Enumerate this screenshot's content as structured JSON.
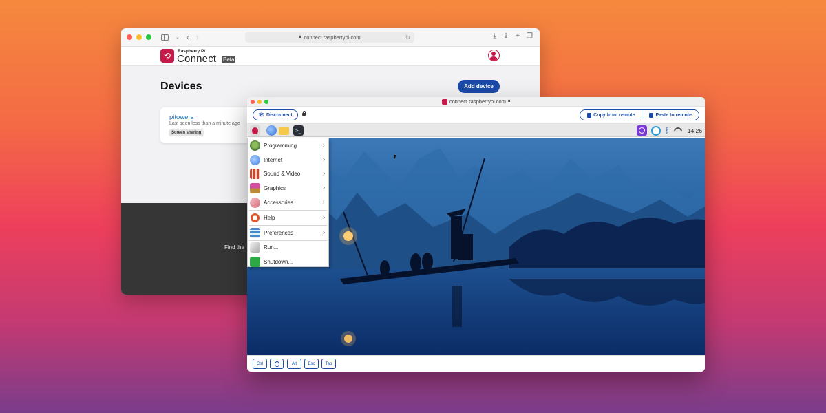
{
  "back_window": {
    "url": "connect.raspberrypi.com",
    "brand_small": "Raspberry Pi",
    "brand_big": "Connect",
    "beta": "Beta",
    "page_title": "Devices",
    "add_device_label": "Add device",
    "device": {
      "name": "pitowers",
      "last_seen": "Last seen less than a minute ago",
      "badge": "Screen sharing"
    },
    "footer_text": "Find the"
  },
  "front_window": {
    "title": "connect.raspberrypi.com",
    "disconnect_label": "Disconnect",
    "copy_label": "Copy from remote",
    "paste_label": "Paste to remote",
    "clock": "14:26",
    "menu": [
      {
        "label": "Programming",
        "icon": "programming-icon",
        "submenu": true
      },
      {
        "label": "Internet",
        "icon": "internet-icon",
        "submenu": true
      },
      {
        "label": "Sound & Video",
        "icon": "sound-video-icon",
        "submenu": true
      },
      {
        "label": "Graphics",
        "icon": "graphics-icon",
        "submenu": true
      },
      {
        "label": "Accessories",
        "icon": "accessories-icon",
        "submenu": true
      },
      {
        "label": "Help",
        "icon": "help-icon",
        "submenu": true
      },
      {
        "label": "Preferences",
        "icon": "preferences-icon",
        "submenu": true
      },
      {
        "label": "Run...",
        "icon": "run-icon",
        "submenu": false
      },
      {
        "label": "Shutdown...",
        "icon": "shutdown-icon",
        "submenu": false
      }
    ],
    "keys": [
      "Ctrl",
      "",
      "Alt",
      "Esc",
      "Tab"
    ]
  },
  "colors": {
    "accent_blue": "#1a4ba8",
    "raspberry_red": "#c51a4a"
  }
}
